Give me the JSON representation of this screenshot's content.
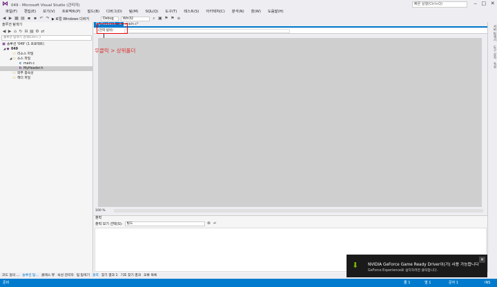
{
  "titlebar": {
    "title": "049 - Microsoft Visual Studio (관리자)",
    "quick_launch": "빠른 실행(Ctrl+Q)",
    "minimize": "‒",
    "maximize": "□",
    "close": "✕"
  },
  "menu": [
    "파일(F)",
    "편집(E)",
    "보기(V)",
    "프로젝트(P)",
    "빌드(B)",
    "디버그(D)",
    "팀(M)",
    "SQL(Q)",
    "도구(T)",
    "테스트(S)",
    "아키텍처(C)",
    "분석(N)",
    "창(W)",
    "도움말(H)"
  ],
  "toolbar": {
    "run_label": "▶ 로컬 Windows 디버거",
    "config": "Debug",
    "platform": "Win32"
  },
  "solution_explorer": {
    "header": "솔루션 탐색기",
    "search_placeholder": "솔루션 탐색기 검색(Ctrl+;)",
    "items": [
      {
        "label": "솔루션 '049' (1 프로젝트)",
        "glyph": "",
        "icon": "▣"
      },
      {
        "label": "049",
        "glyph": "◢",
        "icon": "◆"
      },
      {
        "label": "리소스 파일",
        "glyph": "",
        "icon": "▭"
      },
      {
        "label": "소스 파일",
        "glyph": "◢",
        "icon": "▭"
      },
      {
        "label": "main.c",
        "glyph": "",
        "icon": "c"
      },
      {
        "label": "MyHeader.h",
        "glyph": "",
        "icon": "h"
      },
      {
        "label": "외부 종속성",
        "glyph": "",
        "icon": "▭"
      },
      {
        "label": "헤더 파일",
        "glyph": "",
        "icon": "▭"
      }
    ]
  },
  "editor": {
    "active_tab": "MyHeader.h",
    "active_tab_pin": "⊕ ✕",
    "inactive_tab": "main.c*",
    "nav_scope": "(전역 범위)",
    "annotation": "우클릭 > 상위폴더",
    "zoom": "100 %"
  },
  "output": {
    "header": "출력",
    "show_label": "출력 보기 선택(S):",
    "source": "빌드"
  },
  "bottom_tabs": [
    "코드 정의 ...",
    "솔루션 탐...",
    "클래스 뷰",
    "속성 관리자",
    "팀 탐색기",
    "출력",
    "찾기 결과 1",
    "기호 찾기 결과",
    "오류 목록"
  ],
  "status": {
    "ready": "준비",
    "ln": "줄 1",
    "col": "열 1",
    "ch": "문자 1",
    "ins": "INS"
  },
  "notification": {
    "title": "NVIDIA GeForce Game Ready Driver이(가) 사용 가능합니다",
    "subtitle": "GeForce Experience로 설치하려면 클릭합니다.",
    "close": "✕"
  },
  "right_tabs": [
    "서버 탐색기",
    "도구 상자",
    "속성"
  ]
}
